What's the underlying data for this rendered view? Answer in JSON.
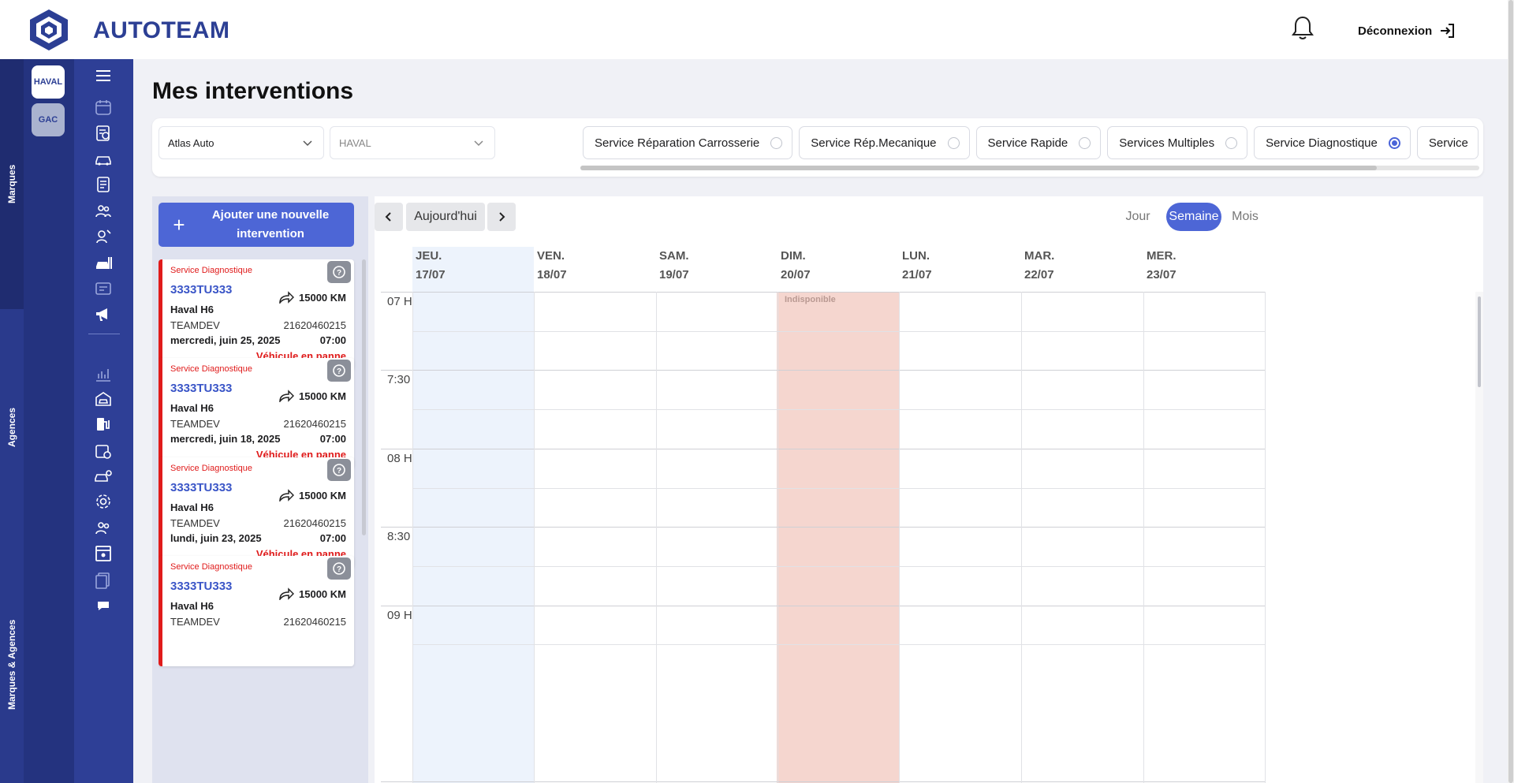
{
  "header": {
    "brand": "AUTOTEAM",
    "logout_label": "Déconnexion"
  },
  "left_rail": {
    "sections": [
      "Marques",
      "Agences",
      "Marques & Agences"
    ]
  },
  "brands": [
    {
      "label": "HAVAL",
      "active": true
    },
    {
      "label": "GAC",
      "active": false
    }
  ],
  "nav_icons": [
    "menu-icon",
    "calendar-icon",
    "clipboard-search-icon",
    "car-icon",
    "checklist-icon",
    "users-icon",
    "mechanic-icon",
    "car-wash-icon",
    "invoice-icon",
    "megaphone-icon",
    "chart-icon",
    "garage-icon",
    "fuel-pump-icon",
    "calendar-refresh-icon",
    "car-settings-icon",
    "gear-icon",
    "team-icon",
    "id-card-icon",
    "documents-icon",
    "chat-icon"
  ],
  "page": {
    "title": "Mes interventions"
  },
  "filters": {
    "agency": "Atlas Auto",
    "brand": "HAVAL",
    "services": [
      {
        "label": "Service Réparation Carrosserie",
        "selected": false
      },
      {
        "label": "Service Rép.Mecanique",
        "selected": false
      },
      {
        "label": "Service Rapide",
        "selected": false
      },
      {
        "label": "Services Multiples",
        "selected": false
      },
      {
        "label": "Service Diagnostique",
        "selected": true
      },
      {
        "label": "Service",
        "selected": false
      }
    ]
  },
  "add_button": {
    "label": "Ajouter une nouvelle intervention"
  },
  "interventions": [
    {
      "service": "Service Diagnostique",
      "plate": "3333TU333",
      "km": "15000 KM",
      "model": "Haval H6",
      "client": "TEAMDEV",
      "phone": "21620460215",
      "date": "mercredi, juin 25, 2025",
      "time": "07:00",
      "status": "Véhicule en panne"
    },
    {
      "service": "Service Diagnostique",
      "plate": "3333TU333",
      "km": "15000 KM",
      "model": "Haval H6",
      "client": "TEAMDEV",
      "phone": "21620460215",
      "date": "mercredi, juin 18, 2025",
      "time": "07:00",
      "status": "Véhicule en panne"
    },
    {
      "service": "Service Diagnostique",
      "plate": "3333TU333",
      "km": "15000 KM",
      "model": "Haval H6",
      "client": "TEAMDEV",
      "phone": "21620460215",
      "date": "lundi, juin 23, 2025",
      "time": "07:00",
      "status": "Véhicule en panne"
    },
    {
      "service": "Service Diagnostique",
      "plate": "3333TU333",
      "km": "15000 KM",
      "model": "Haval H6",
      "client": "TEAMDEV",
      "phone": "21620460215",
      "date": "",
      "time": "",
      "status": ""
    }
  ],
  "calendar": {
    "today_label": "Aujourd'hui",
    "views": [
      {
        "label": "Jour",
        "active": false
      },
      {
        "label": "Semaine",
        "active": true
      },
      {
        "label": "Mois",
        "active": false
      }
    ],
    "days": [
      {
        "name": "JEU.",
        "date": "17/07",
        "today": true
      },
      {
        "name": "VEN.",
        "date": "18/07"
      },
      {
        "name": "SAM.",
        "date": "19/07"
      },
      {
        "name": "DIM.",
        "date": "20/07",
        "unavailable": true
      },
      {
        "name": "LUN.",
        "date": "21/07"
      },
      {
        "name": "MAR.",
        "date": "22/07"
      },
      {
        "name": "MER.",
        "date": "23/07"
      }
    ],
    "hours": [
      "07 H",
      "7:30",
      "08 H",
      "8:30",
      "09 H"
    ],
    "unavailable_label": "Indisponible"
  },
  "colors": {
    "primary": "#4d66d6",
    "sidebar": "#2e3f96",
    "danger": "#e01b1b",
    "unavailable": "#f5d6cf"
  }
}
